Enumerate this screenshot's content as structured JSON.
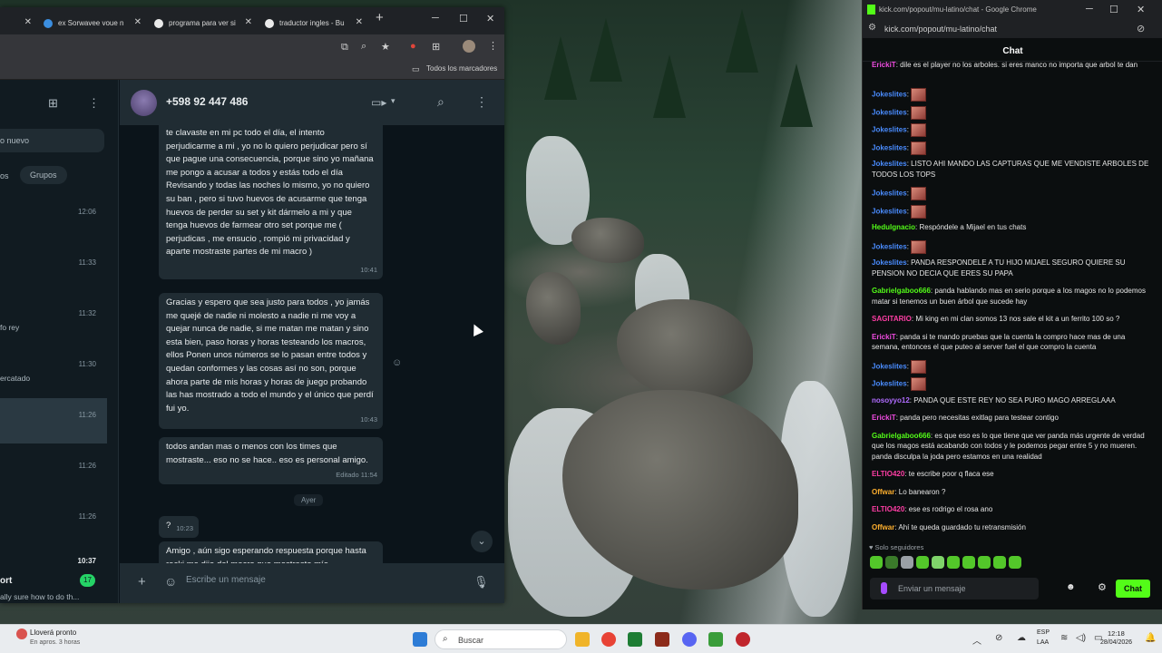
{
  "left_window": {
    "tabs": [
      {
        "label": "ex Sorwavee voue n"
      },
      {
        "label": "programa para ver si"
      },
      {
        "label": "traductor ingles - Bu"
      }
    ],
    "bookmarks_label": "Todos los marcadores"
  },
  "wa_list": {
    "search_hint": "o nuevo",
    "filter_groups": "Grupos",
    "filter_other": "os",
    "items": [
      {
        "time": "12:06",
        "snippet": ""
      },
      {
        "time": "11:33",
        "snippet": ""
      },
      {
        "time": "11:32",
        "snippet": "fo rey"
      },
      {
        "time": "11:30",
        "snippet": "ercatado"
      },
      {
        "time": "11:26",
        "snippet": ""
      },
      {
        "time": "11:26",
        "snippet": ""
      },
      {
        "time": "11:26",
        "snippet": ""
      },
      {
        "time": "10:37",
        "snippet": "ort"
      }
    ],
    "last_snippet": "ally sure how to do th...",
    "unread_badge": "17"
  },
  "wa_chat": {
    "contact": "+598 92 447 486",
    "messages": [
      {
        "text": "te clavaste en mi pc todo el día, el intento perjudicarme a mi , yo no lo quiero perjudicar pero sí que pague una consecuencia, porque sino yo mañana me pongo a acusar a todos y estás todo el día Revisando y todas las noches lo mismo, yo no quiero su ban , pero si tuvo huevos de acusarme que tenga huevos de perder su set y kit dármelo a mi y que tenga huevos de farmear otro set porque me ( perjudicas , me ensucio , rompió mi privacidad y aparte mostraste partes de mi macro )",
        "time": "10:41"
      },
      {
        "text": "Gracias y espero que sea justo para todos , yo jamás me quejé de nadie ni molesto a nadie ni me voy a quejar nunca de nadie, si me matan me matan y sino esta bien, paso horas y horas testeando los macros, ellos Ponen unos números se lo pasan entre todos y quedan conformes y las cosas así no son, porque ahora parte de mis horas y horas de juego probando las has mostrado a todo el mundo y el único que perdí fui yo.",
        "time": "10:43"
      },
      {
        "text": "todos andan mas o menos con los times que mostraste... eso no se hace.. eso es personal amigo.",
        "time": "Editado 11:54"
      },
      {
        "text": "?",
        "time": "10:23"
      },
      {
        "text": "Amigo , aún sigo esperando respuesta porque hasta rocki me dijo del macro que mostraste mío",
        "time": ""
      }
    ],
    "day_chip": "Ayer",
    "input_placeholder": "Escribe un mensaje"
  },
  "right_window": {
    "title": "kick.com/popout/mu-latino/chat - Google Chrome",
    "url": "kick.com/popout/mu-latino/chat",
    "header": "Chat",
    "messages": [
      {
        "user": "ErickiT",
        "color": "#ef4ce0",
        "text": "dile es el player no los arboles. si eres manco no importa que arbol te dan",
        "emotes": 0
      },
      {
        "user": "Jokeslites",
        "color": "#4a8cff",
        "text": "",
        "emotes": 1
      },
      {
        "user": "Jokeslites",
        "color": "#4a8cff",
        "text": "",
        "emotes": 1
      },
      {
        "user": "Jokeslites",
        "color": "#4a8cff",
        "text": "",
        "emotes": 1
      },
      {
        "user": "Jokeslites",
        "color": "#4a8cff",
        "text": "",
        "emotes": 1
      },
      {
        "user": "Jokeslites",
        "color": "#4a8cff",
        "text": "LISTO AHI MANDO LAS CAPTURAS QUE ME VENDISTE ARBOLES DE TODOS LOS TOPS",
        "emotes": 0
      },
      {
        "user": "Jokeslites",
        "color": "#4a8cff",
        "text": "",
        "emotes": 1
      },
      {
        "user": "Jokeslites",
        "color": "#4a8cff",
        "text": "",
        "emotes": 1
      },
      {
        "user": "Hedulgnacio",
        "color": "#53fc18",
        "text": "Respóndele a Mijael en tus chats",
        "emotes": 0
      },
      {
        "user": "Jokeslites",
        "color": "#4a8cff",
        "text": "",
        "emotes": 1
      },
      {
        "user": "Jokeslites",
        "color": "#4a8cff",
        "text": "PANDA RESPONDELE A TU HIJO MIJAEL SEGURO QUIERE SU PENSION NO DECIA QUE ERES SU PAPA",
        "emotes": 0
      },
      {
        "user": "Gabrielgaboo666",
        "color": "#53fc18",
        "text": "panda hablando mas en serio porque a los magos no lo podemos matar si tenemos un buen árbol que sucede hay",
        "emotes": 0
      },
      {
        "user": "SAGITARIO",
        "color": "#ff3ea5",
        "text": "Mi king en mi clan somos 13 nos sale el kit a un ferrito 100 so ?",
        "emotes": 0
      },
      {
        "user": "ErickiT",
        "color": "#ef4ce0",
        "text": "panda si te mando pruebas que la cuenta la compro hace mas de una semana, entonces el que puteo al server fuel el que compro la cuenta",
        "emotes": 0
      },
      {
        "user": "Jokeslites",
        "color": "#4a8cff",
        "text": "",
        "emotes": 1
      },
      {
        "user": "Jokeslites",
        "color": "#4a8cff",
        "text": "",
        "emotes": 1
      },
      {
        "user": "nosoyyo12",
        "color": "#b06cff",
        "text": "PANDA QUE ESTE REY NO SEA PURO MAGO ARREGLAAA",
        "emotes": 0
      },
      {
        "user": "ErickiT",
        "color": "#ef4ce0",
        "text": "panda pero necesitas exitlag para testear contigo",
        "emotes": 0
      },
      {
        "user": "Gabrielgaboo666",
        "color": "#53fc18",
        "text": "es que eso es lo que tiene que ver panda más urgente de verdad que los magos está acabando con todos y le podemos pegar entre 5 y no mueren. panda disculpa la joda pero estamos en una realidad",
        "emotes": 0
      },
      {
        "user": "ELTIO420",
        "color": "#ff3ea5",
        "text": "te escribe poor q flaca ese",
        "emotes": 0
      },
      {
        "user": "Offwar",
        "color": "#ffb02e",
        "text": "Lo banearon ?",
        "emotes": 0
      },
      {
        "user": "ELTIO420",
        "color": "#ff3ea5",
        "text": "ese es rodrigo el rosa ano",
        "emotes": 0
      },
      {
        "user": "Offwar",
        "color": "#ffb02e",
        "text": "Ahí te queda guardado tu retransmisión",
        "emotes": 0
      }
    ],
    "followers_only": "Solo seguidores",
    "input_placeholder": "Enviar un mensaje",
    "send_label": "Chat"
  },
  "taskbar": {
    "weather_title": "Lloverá pronto",
    "weather_sub": "En apros. 3 horas",
    "search_placeholder": "Buscar",
    "lang_top": "ESP",
    "lang_bottom": "LAA",
    "clock_time": "12:18",
    "clock_date": "28/04/2026"
  }
}
